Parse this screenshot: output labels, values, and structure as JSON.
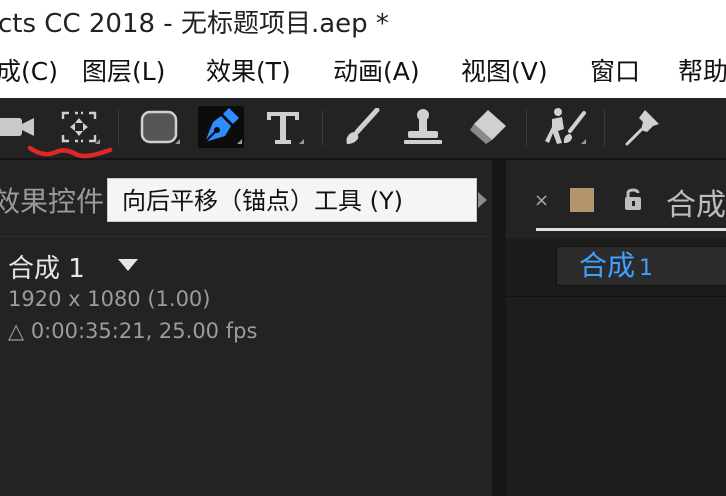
{
  "window": {
    "title": "cts CC 2018 - 无标题项目.aep *"
  },
  "menu": {
    "items": [
      {
        "label": "成(C)"
      },
      {
        "label": "图层(L)"
      },
      {
        "label": "效果(T)"
      },
      {
        "label": "动画(A)"
      },
      {
        "label": "视图(V)"
      },
      {
        "label": "窗口"
      },
      {
        "label": "帮助"
      }
    ]
  },
  "toolbar": {
    "tools": [
      {
        "icon": "camera-icon"
      },
      {
        "icon": "pan-behind-anchor-icon"
      },
      {
        "icon": "rectangle-shape-icon"
      },
      {
        "icon": "pen-tool-icon",
        "active": true
      },
      {
        "icon": "text-tool-icon"
      },
      {
        "icon": "brush-icon"
      },
      {
        "icon": "clone-stamp-icon"
      },
      {
        "icon": "eraser-icon"
      },
      {
        "icon": "roto-brush-icon"
      },
      {
        "icon": "puppet-pin-icon"
      }
    ],
    "active_color": "#2d8cff",
    "highlight_mark_color": "#e0262b"
  },
  "tooltip": {
    "text": "向后平移（锚点）工具 (Y)"
  },
  "effects_panel": {
    "tab_label": "效果控件",
    "comp_name": "合成 1",
    "resolution": "1920 x 1080 (1.00)",
    "duration": "△ 0:00:35:21, 25.00 fps"
  },
  "comp_panel": {
    "close_glyph": "×",
    "tab_label": "合成",
    "swatch_color": "#b3946d",
    "comp_tab_name": "合成",
    "comp_tab_number": "1",
    "comp_tab_color": "#3ea0ff"
  }
}
